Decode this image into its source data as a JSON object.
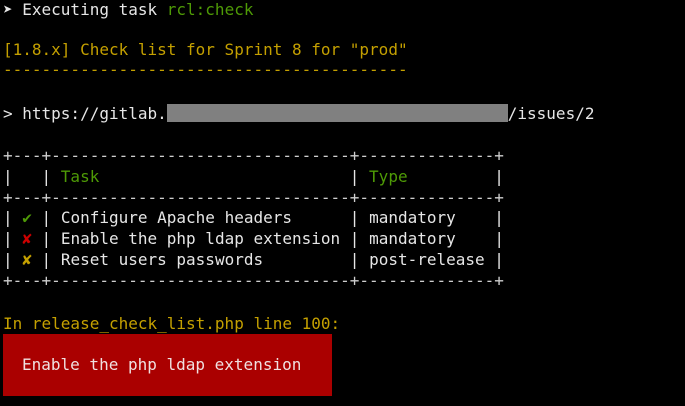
{
  "terminal": {
    "executing_prefix": "➤ Executing task ",
    "task_name": "rcl:check",
    "checklist_title": "[1.8.x] Check list for Sprint 8 for \"prod\"",
    "title_underline": "------------------------------------------",
    "url_prefix": "> https://gitlab.",
    "url_suffix": "/issues/2",
    "table": {
      "border": "+---+-------------------------------+--------------+",
      "headers": {
        "status": "",
        "task": "Task",
        "type": "Type"
      },
      "rows": [
        {
          "status": "✔",
          "status_color": "#4e9a06",
          "task": "Configure Apache headers",
          "type": "mandatory"
        },
        {
          "status": "✘",
          "status_color": "#cc0000",
          "task": "Enable the php ldap extension",
          "type": "mandatory"
        },
        {
          "status": "✘",
          "status_color": "#c4a000",
          "task": "Reset users passwords",
          "type": "post-release"
        }
      ]
    },
    "error_location": "In release_check_list.php line 100:",
    "error_message": "Enable the php ldap extension"
  },
  "colors": {
    "background": "#000000",
    "gold": "#c4a000",
    "green": "#4e9a06",
    "red": "#cc0000",
    "error_bg": "#aa0000"
  }
}
